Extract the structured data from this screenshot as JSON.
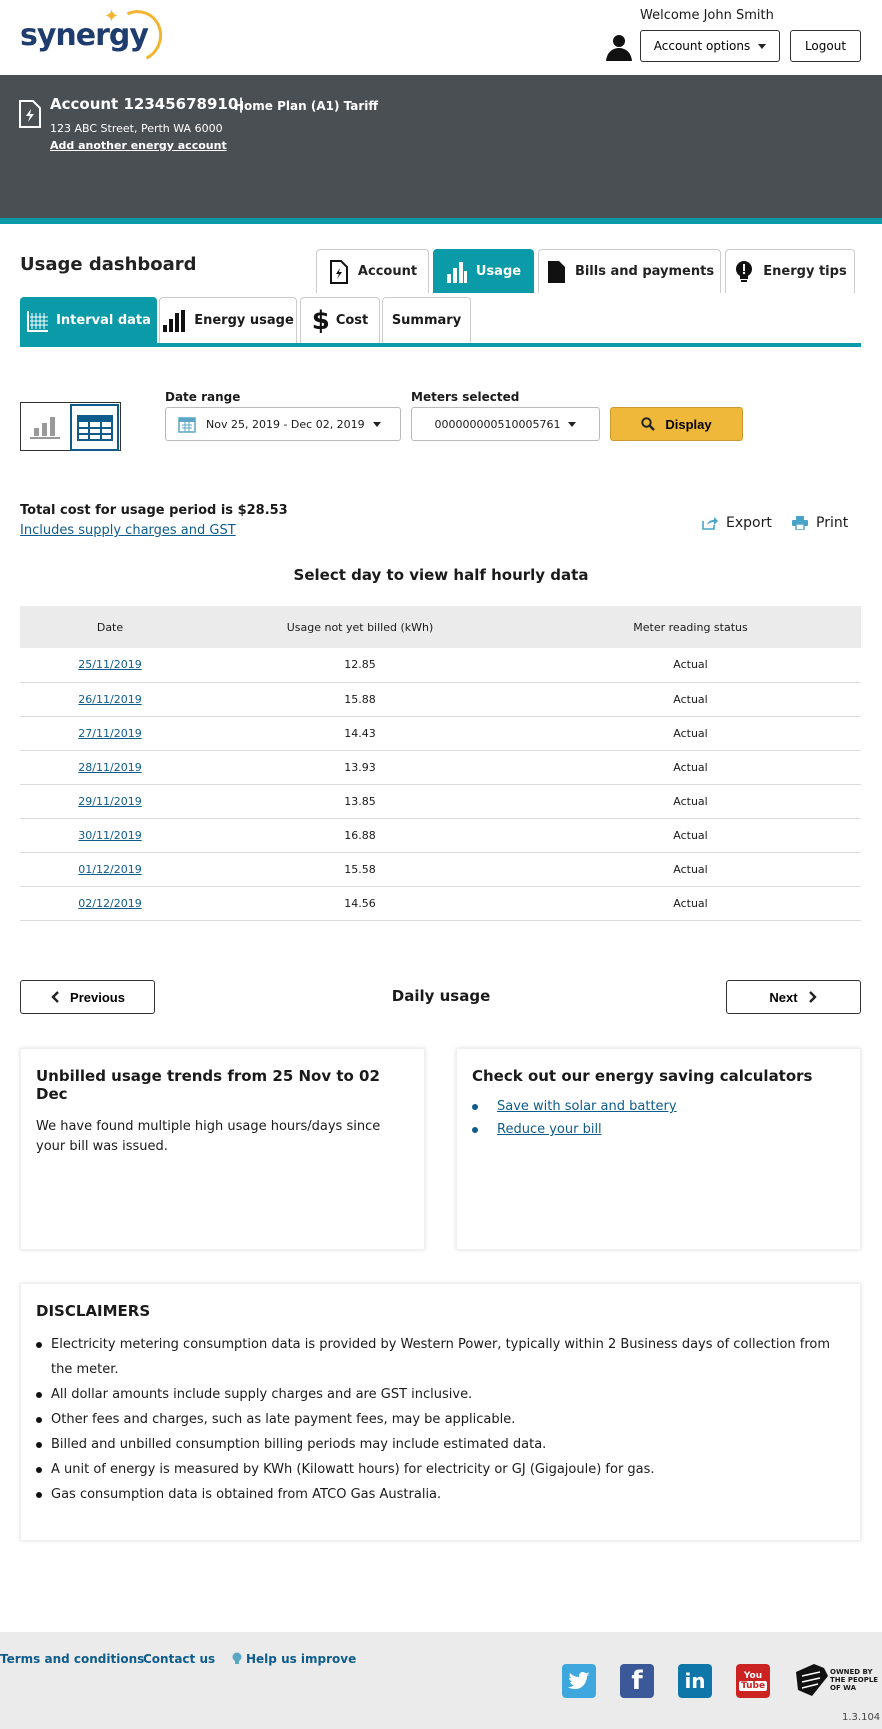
{
  "header": {
    "logo_text": "synergy",
    "welcome": "Welcome John Smith",
    "account_options_label": "Account options",
    "logout_label": "Logout"
  },
  "account": {
    "number": "Account 12345678910",
    "plan": "Home Plan (A1) Tariff",
    "address": "123 ABC Street, Perth WA 6000",
    "add_account_link": "Add another energy account"
  },
  "main_tabs": [
    {
      "label": "Account",
      "icon": "document-lightning-icon",
      "active": false
    },
    {
      "label": "Usage",
      "icon": "bar-chart-icon",
      "active": true
    },
    {
      "label": "Bills and payments",
      "icon": "document-icon",
      "active": false
    },
    {
      "label": "Energy tips",
      "icon": "lightbulb-icon",
      "active": false
    }
  ],
  "dashboard": {
    "title": "Usage dashboard",
    "sub_tabs": [
      {
        "label": "Interval data",
        "icon": "grid-chart-icon",
        "active": true
      },
      {
        "label": "Energy usage",
        "icon": "bar-chart-icon",
        "active": false
      },
      {
        "label": "Cost",
        "icon": "dollar-icon",
        "active": false
      },
      {
        "label": "Summary",
        "icon": "",
        "active": false
      }
    ]
  },
  "filters": {
    "date_range_label": "Date range",
    "date_range_value": "Nov 25, 2019 - Dec 02, 2019",
    "meters_label": "Meters selected",
    "meters_value": "000000000510005761",
    "display_label": "Display"
  },
  "summary": {
    "total_cost": "Total cost for usage period is $28.53",
    "includes_link": "Includes supply charges and GST",
    "export_label": "Export",
    "print_label": "Print",
    "select_day": "Select day to view half hourly data"
  },
  "table": {
    "headers": [
      "Date",
      "Usage not yet billed (kWh)",
      "Meter reading status"
    ],
    "rows": [
      [
        "25/11/2019",
        "12.85",
        "Actual"
      ],
      [
        "26/11/2019",
        "15.88",
        "Actual"
      ],
      [
        "27/11/2019",
        "14.43",
        "Actual"
      ],
      [
        "28/11/2019",
        "13.93",
        "Actual"
      ],
      [
        "29/11/2019",
        "13.85",
        "Actual"
      ],
      [
        "30/11/2019",
        "16.88",
        "Actual"
      ],
      [
        "01/12/2019",
        "15.58",
        "Actual"
      ],
      [
        "02/12/2019",
        "14.56",
        "Actual"
      ]
    ]
  },
  "pager": {
    "previous_label": "Previous",
    "center_label": "Daily usage",
    "next_label": "Next"
  },
  "trends_card": {
    "title": "Unbilled usage trends from 25 Nov to 02 Dec",
    "body": "We have found multiple high usage hours/days since your bill was issued."
  },
  "calculators_card": {
    "title": "Check out our energy saving calculators",
    "links": [
      "Save with solar and battery",
      "Reduce your bill"
    ]
  },
  "disclaimers": {
    "title": "DISCLAIMERS",
    "items": [
      "Electricity metering consumption data is provided by Western Power, typically within 2 Business days of collection from the meter.",
      "All dollar amounts include supply charges and are GST inclusive.",
      "Other fees and charges, such as late payment fees, may be applicable.",
      "Billed and unbilled consumption billing periods may include estimated data.",
      "A unit of energy is measured by KWh (Kilowatt hours) for electricity or GJ (Gigajoule) for gas.",
      "Gas consumption data is obtained from ATCO Gas Australia."
    ]
  },
  "footer": {
    "links": [
      "Terms and conditions",
      "Contact us",
      "Help us improve"
    ],
    "owned_lines": [
      "OWNED BY",
      "THE PEOPLE",
      "OF WA"
    ],
    "social": [
      "twitter-icon",
      "facebook-icon",
      "linkedin-icon",
      "youtube-icon"
    ],
    "youtube_text": [
      "You",
      "Tube"
    ],
    "version": "1.3.104"
  },
  "colors": {
    "teal": "#0a9aa8",
    "dark_bar": "#4a4f53",
    "display_button": "#f0b83a",
    "link": "#0e5c8c"
  }
}
